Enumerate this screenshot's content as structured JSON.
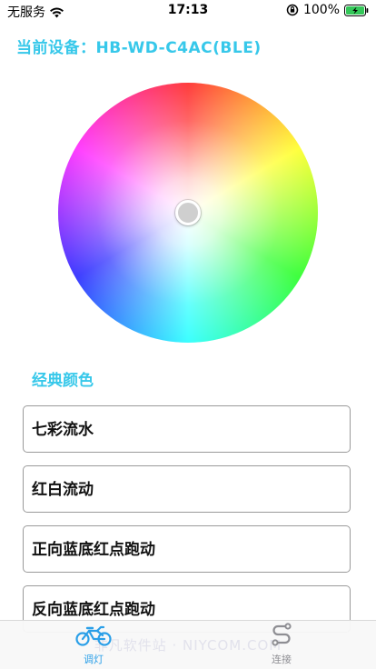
{
  "status_bar": {
    "carrier": "无服务",
    "time": "17:13",
    "battery_percent": "100%"
  },
  "device": {
    "line": "当前设备：HB-WD-C4AC(BLE)"
  },
  "classic_colors": {
    "title": "经典颜色",
    "items": [
      {
        "label": "七彩流水"
      },
      {
        "label": "红白流动"
      },
      {
        "label": "正向蓝底红点跑动"
      },
      {
        "label": "反向蓝底红点跑动"
      }
    ]
  },
  "tab_bar": {
    "tabs": [
      {
        "label": "调灯",
        "icon": "motorcycle-icon",
        "active": true
      },
      {
        "label": "连接",
        "icon": "connect-path-icon",
        "active": false
      }
    ],
    "watermark": "非凡软件站 · NIYCOM.COM"
  },
  "colors": {
    "accent": "#37c8ea",
    "tab_active": "#2a9fe8",
    "tab_inactive": "#8e8e93",
    "battery": "#34c759"
  }
}
